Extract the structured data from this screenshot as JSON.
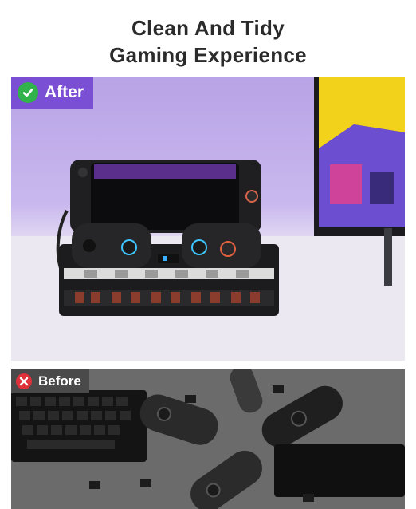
{
  "headline": {
    "line1": "Clean And Tidy",
    "line2": "Gaming Experience"
  },
  "after": {
    "label": "After",
    "icon": "check-icon"
  },
  "before": {
    "label": "Before",
    "icon": "x-icon"
  },
  "colors": {
    "after_accent": "#7a4fd4",
    "check_green": "#2fb34a",
    "x_red": "#e0303a"
  }
}
